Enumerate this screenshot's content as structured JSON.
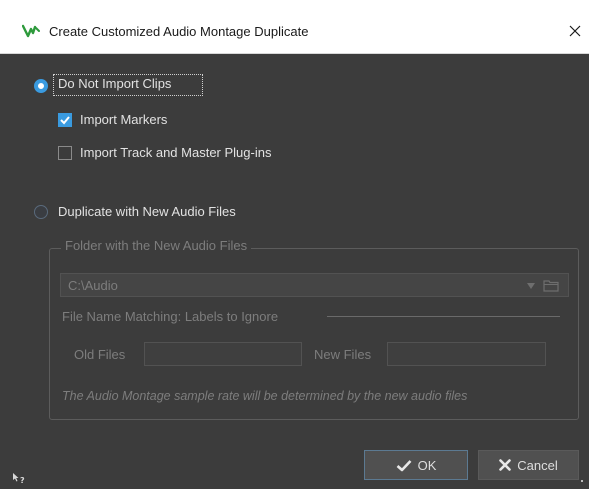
{
  "window": {
    "title": "Create Customized Audio Montage Duplicate",
    "app_icon": "wavelab-logo-icon",
    "close_icon": "close-icon"
  },
  "import_mode": {
    "option_no_clips": "Do Not Import Clips",
    "option_no_clips_selected": true,
    "import_markers": "Import Markers",
    "import_markers_checked": true,
    "import_plugins": "Import Track and Master Plug-ins",
    "import_plugins_checked": false,
    "option_duplicate": "Duplicate with New Audio Files",
    "option_duplicate_selected": false
  },
  "new_files_group": {
    "legend": "Folder with the New Audio Files",
    "folder_value": "C:\\Audio",
    "folder_icons": [
      "dropdown-arrow-icon",
      "folder-icon"
    ],
    "matching_label": "File Name Matching: Labels to Ignore",
    "old_files_label": "Old Files",
    "old_files_value": "",
    "new_files_label": "New Files",
    "new_files_value": "",
    "note": "The Audio Montage sample rate will be determined by the new audio files"
  },
  "buttons": {
    "ok_label": "OK",
    "ok_icon": "checkmark-icon",
    "cancel_label": "Cancel",
    "cancel_icon": "x-icon"
  },
  "footer": {
    "help_icon": "whats-this-help-icon"
  },
  "colors": {
    "accent": "#3a9be0",
    "background": "#3c3c3c",
    "titlebar": "#ffffff",
    "text": "#e2e2e2",
    "disabled_text": "#7d7d7d"
  }
}
